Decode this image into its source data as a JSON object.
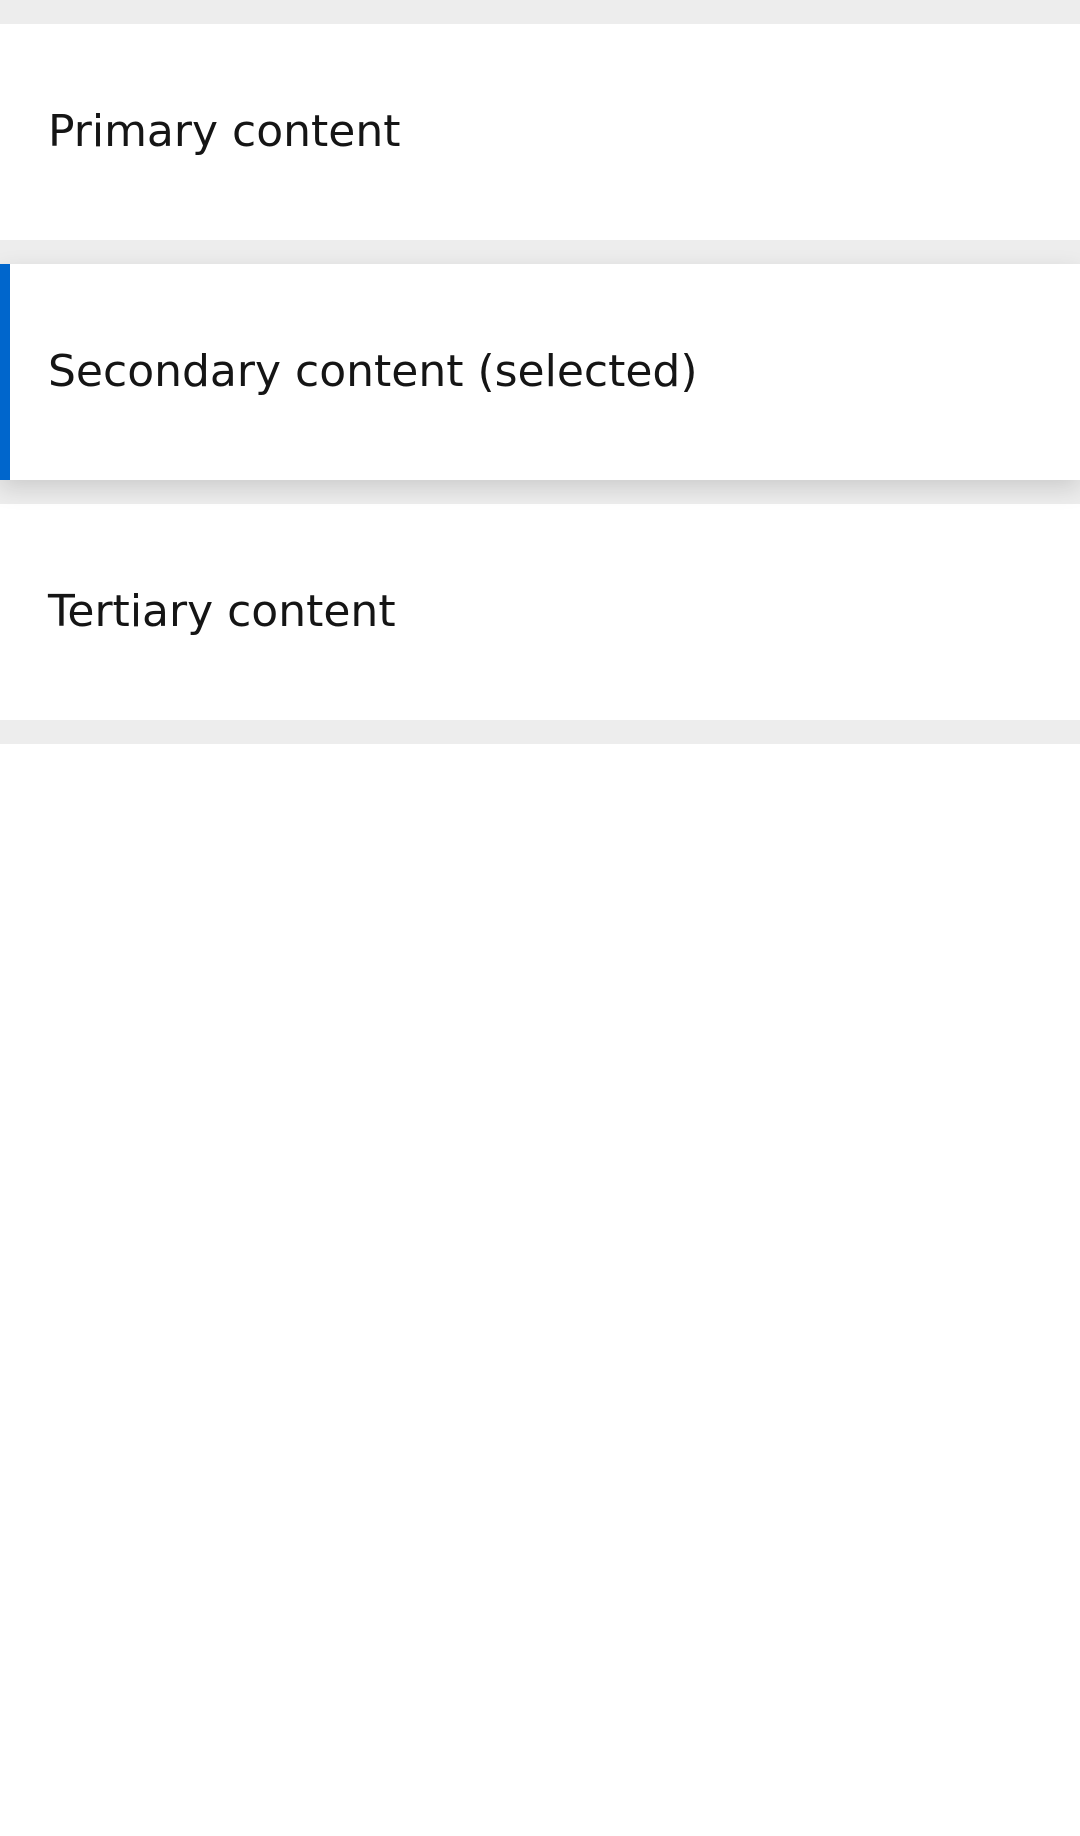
{
  "list": {
    "items": [
      {
        "label": "Primary content",
        "selected": false
      },
      {
        "label": "Secondary content (selected)",
        "selected": true
      },
      {
        "label": "Tertiary content",
        "selected": false
      }
    ]
  },
  "colors": {
    "background": "#ffffff",
    "divider": "#ededed",
    "selected_accent": "#0066cc",
    "text": "#151515"
  }
}
